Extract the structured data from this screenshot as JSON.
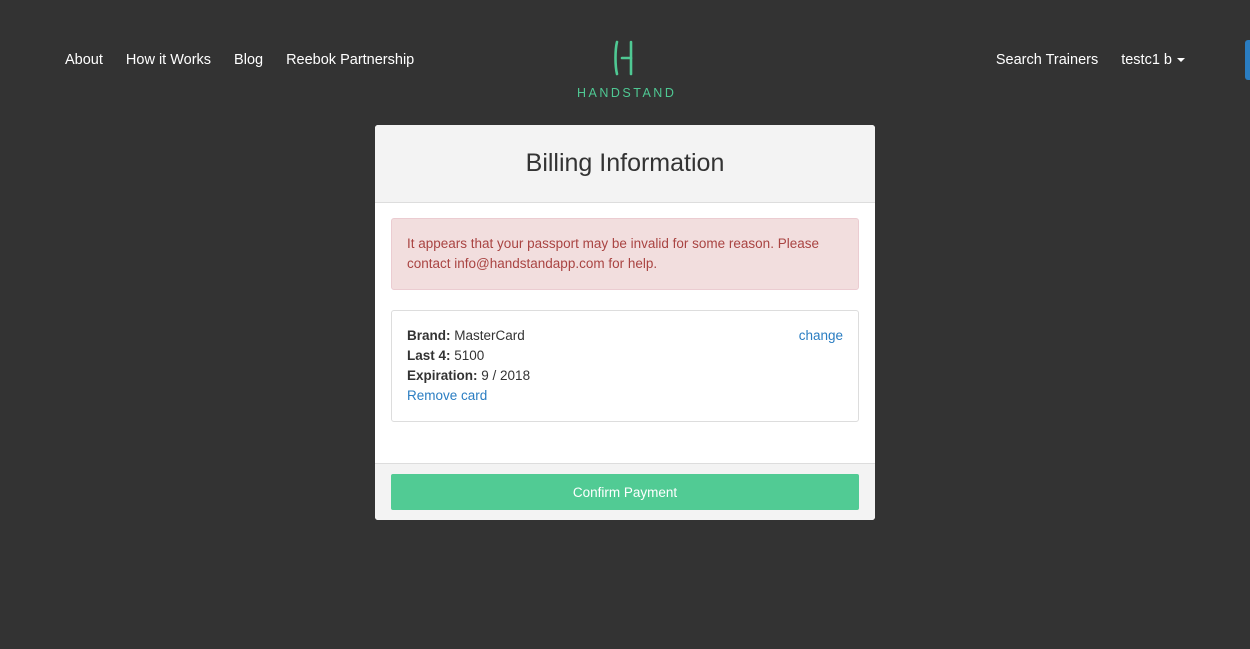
{
  "nav": {
    "left": [
      {
        "label": "About"
      },
      {
        "label": "How it Works"
      },
      {
        "label": "Blog"
      },
      {
        "label": "Reebok Partnership"
      }
    ],
    "search_trainers": "Search Trainers",
    "user_menu": "testc1 b"
  },
  "logo": {
    "text": "HANDSTAND",
    "color": "#4fc893"
  },
  "billing": {
    "title": "Billing Information",
    "alert": "It appears that your passport may be invalid for some reason. Please contact info@handstandapp.com for help.",
    "card": {
      "brand_label": "Brand:",
      "brand": "MasterCard",
      "last4_label": "Last 4:",
      "last4": "5100",
      "expiration_label": "Expiration:",
      "expiration": "9 / 2018",
      "remove_label": "Remove card",
      "change_label": "change"
    },
    "confirm_label": "Confirm Payment"
  },
  "colors": {
    "background": "#333333",
    "accent": "#51cb94",
    "link": "#2a7dc2",
    "alert_bg": "#f2dede",
    "alert_text": "#a94442"
  }
}
